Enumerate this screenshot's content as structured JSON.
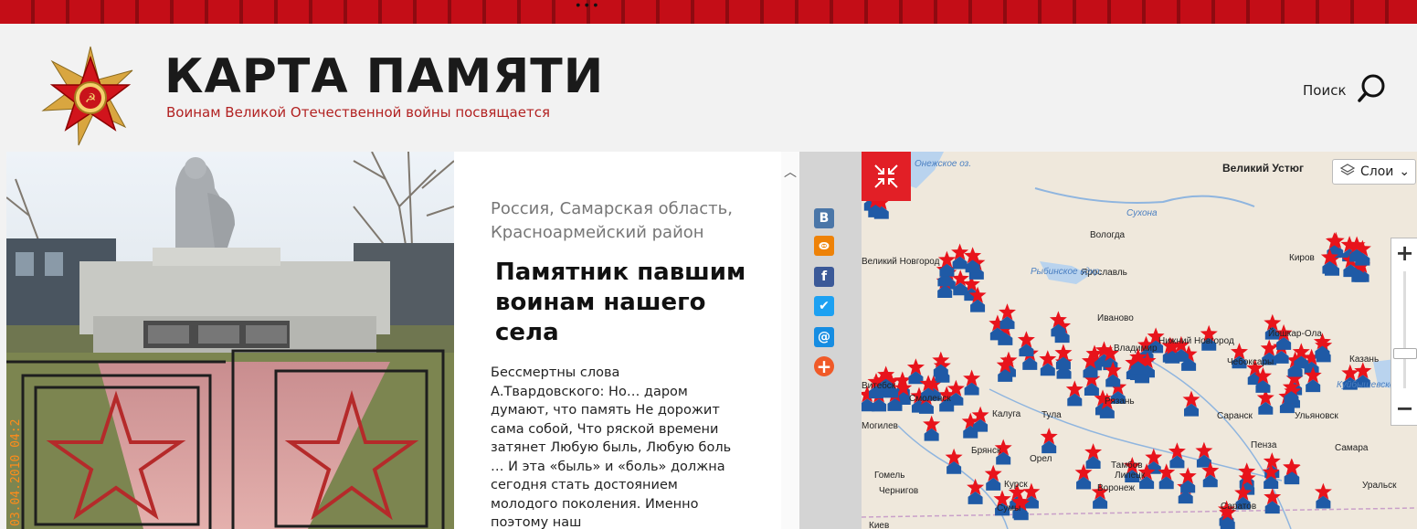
{
  "top_strip_text": "...",
  "header": {
    "title": "КАРТА ПАМЯТИ",
    "subtitle": "Воинам Великой Отечественной войны посвящается",
    "search_label": "Поиск"
  },
  "photo": {
    "timestamp": "03.04.2010 04:2"
  },
  "article": {
    "location": "Россия, Самарская область, Красноармейский район",
    "title": "Памятник павшим воинам нашего села",
    "body": "Бессмертны слова А.Твардовского: Но… даром думают, что память Не дорожит сама собой, Что ряской времени затянет Любую быль, Любую боль … И эта «быль» и «боль» должна сегодня стать достоянием молодого поколения. Именно поэтому наш"
  },
  "share": [
    {
      "icon": "vk-icon",
      "glyph": "В",
      "color": "#4a76a8"
    },
    {
      "icon": "odnoklassniki-icon",
      "glyph": "ok",
      "color": "#ee8208"
    },
    {
      "icon": "facebook-icon",
      "glyph": "f",
      "color": "#3b5998"
    },
    {
      "icon": "twitter-icon",
      "glyph": "t",
      "color": "#1da1f2"
    },
    {
      "icon": "mail-icon",
      "glyph": "@",
      "color": "#168de2"
    },
    {
      "icon": "plus-icon",
      "glyph": "+",
      "color": "#f05a28"
    }
  ],
  "map": {
    "layers_label": "Слои",
    "cities": [
      {
        "name": "Великий Устюг"
      },
      {
        "name": "Вологда"
      },
      {
        "name": "Великий Новгород"
      },
      {
        "name": "Ярославль"
      },
      {
        "name": "Иваново"
      },
      {
        "name": "Киров"
      },
      {
        "name": "Йошкар-Ола"
      },
      {
        "name": "Нижний Новгород"
      },
      {
        "name": "Владимир"
      },
      {
        "name": "Чебоксары"
      },
      {
        "name": "Казань"
      },
      {
        "name": "Витебск"
      },
      {
        "name": "Смоленск"
      },
      {
        "name": "Калуга"
      },
      {
        "name": "Тула"
      },
      {
        "name": "Рязань"
      },
      {
        "name": "Саранск"
      },
      {
        "name": "Ульяновск"
      },
      {
        "name": "Могилев"
      },
      {
        "name": "Брянск"
      },
      {
        "name": "Орел"
      },
      {
        "name": "Тамбов"
      },
      {
        "name": "Пенза"
      },
      {
        "name": "Самара"
      },
      {
        "name": "Гомель"
      },
      {
        "name": "Липецк"
      },
      {
        "name": "Чернигов"
      },
      {
        "name": "Курск"
      },
      {
        "name": "Воронеж"
      },
      {
        "name": "Сумы"
      },
      {
        "name": "Киев"
      },
      {
        "name": "Саратов"
      },
      {
        "name": "Уральск"
      }
    ],
    "water": [
      {
        "name": "Онежское оз."
      },
      {
        "name": "Рыбинское вдхр."
      },
      {
        "name": "Сухона"
      },
      {
        "name": "Куйбышевское вдхр."
      }
    ],
    "marker_count": 140
  },
  "colors": {
    "accent": "#e21f26",
    "site_red": "#b22222",
    "marker_red": "#e8131b",
    "marker_blue": "#1f5aa6"
  }
}
